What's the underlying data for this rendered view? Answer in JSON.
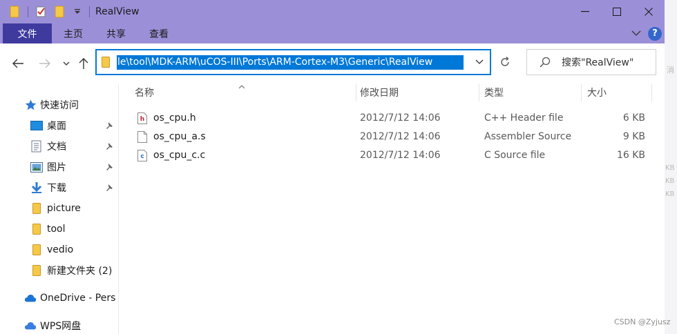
{
  "window": {
    "title": "RealView",
    "controls": {
      "minimize": "—",
      "maximize": "☐",
      "close": "✕"
    }
  },
  "ribbon": {
    "tabs": [
      "文件",
      "主页",
      "共享",
      "查看"
    ]
  },
  "address": {
    "path": "le\\tool\\MDK-ARM\\uCOS-III\\Ports\\ARM-Cortex-M3\\Generic\\RealView"
  },
  "search": {
    "placeholder": "搜索\"RealView\""
  },
  "sidebar": {
    "quick_access": "快速访问",
    "items": [
      {
        "label": "桌面",
        "icon": "desktop-icon",
        "pinned": true
      },
      {
        "label": "文档",
        "icon": "documents-icon",
        "pinned": true
      },
      {
        "label": "图片",
        "icon": "pictures-icon",
        "pinned": true
      },
      {
        "label": "下载",
        "icon": "downloads-icon",
        "pinned": true
      },
      {
        "label": "picture",
        "icon": "folder-icon",
        "pinned": false
      },
      {
        "label": "tool",
        "icon": "folder-icon",
        "pinned": false
      },
      {
        "label": "vedio",
        "icon": "folder-icon",
        "pinned": false
      },
      {
        "label": "新建文件夹 (2)",
        "icon": "folder-icon",
        "pinned": false
      }
    ],
    "onedrive": "OneDrive - Pers",
    "wps": "WPS网盘"
  },
  "columns": {
    "name": "名称",
    "modified": "修改日期",
    "type": "类型",
    "size": "大小"
  },
  "files": [
    {
      "name": "os_cpu.h",
      "modified": "2012/7/12 14:06",
      "type": "C++ Header file",
      "size": "6 KB",
      "icon": "header-file-icon"
    },
    {
      "name": "os_cpu_a.s",
      "modified": "2012/7/12 14:06",
      "type": "Assembler Source",
      "size": "9 KB",
      "icon": "generic-file-icon"
    },
    {
      "name": "os_cpu_c.c",
      "modified": "2012/7/12 14:06",
      "type": "C Source file",
      "size": "16 KB",
      "icon": "c-file-icon"
    }
  ],
  "background": {
    "kb_labels": [
      "KB",
      "KB",
      "KB"
    ],
    "note": "消"
  },
  "watermark": "CSDN @Zyjusz",
  "colors": {
    "titlebar": "#9b90d8",
    "file_tab": "#3f3a9e",
    "accent": "#0078d7"
  }
}
